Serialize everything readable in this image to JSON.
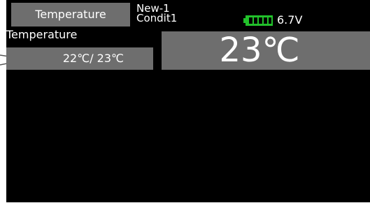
{
  "header": {
    "tab_label": "Temperature",
    "model_name": "New-1",
    "condition_name": "Condit1"
  },
  "battery": {
    "icon": "battery-icon",
    "voltage": "6.7V",
    "level_fraction": 1.0,
    "color": "#22c12b"
  },
  "section": {
    "label": "Temperature"
  },
  "readout": {
    "min_max": "22℃/  23℃",
    "current": "23℃"
  },
  "colors": {
    "screen_bg": "#000000",
    "panel_bg": "#6e6e6e",
    "text": "#ffffff"
  }
}
